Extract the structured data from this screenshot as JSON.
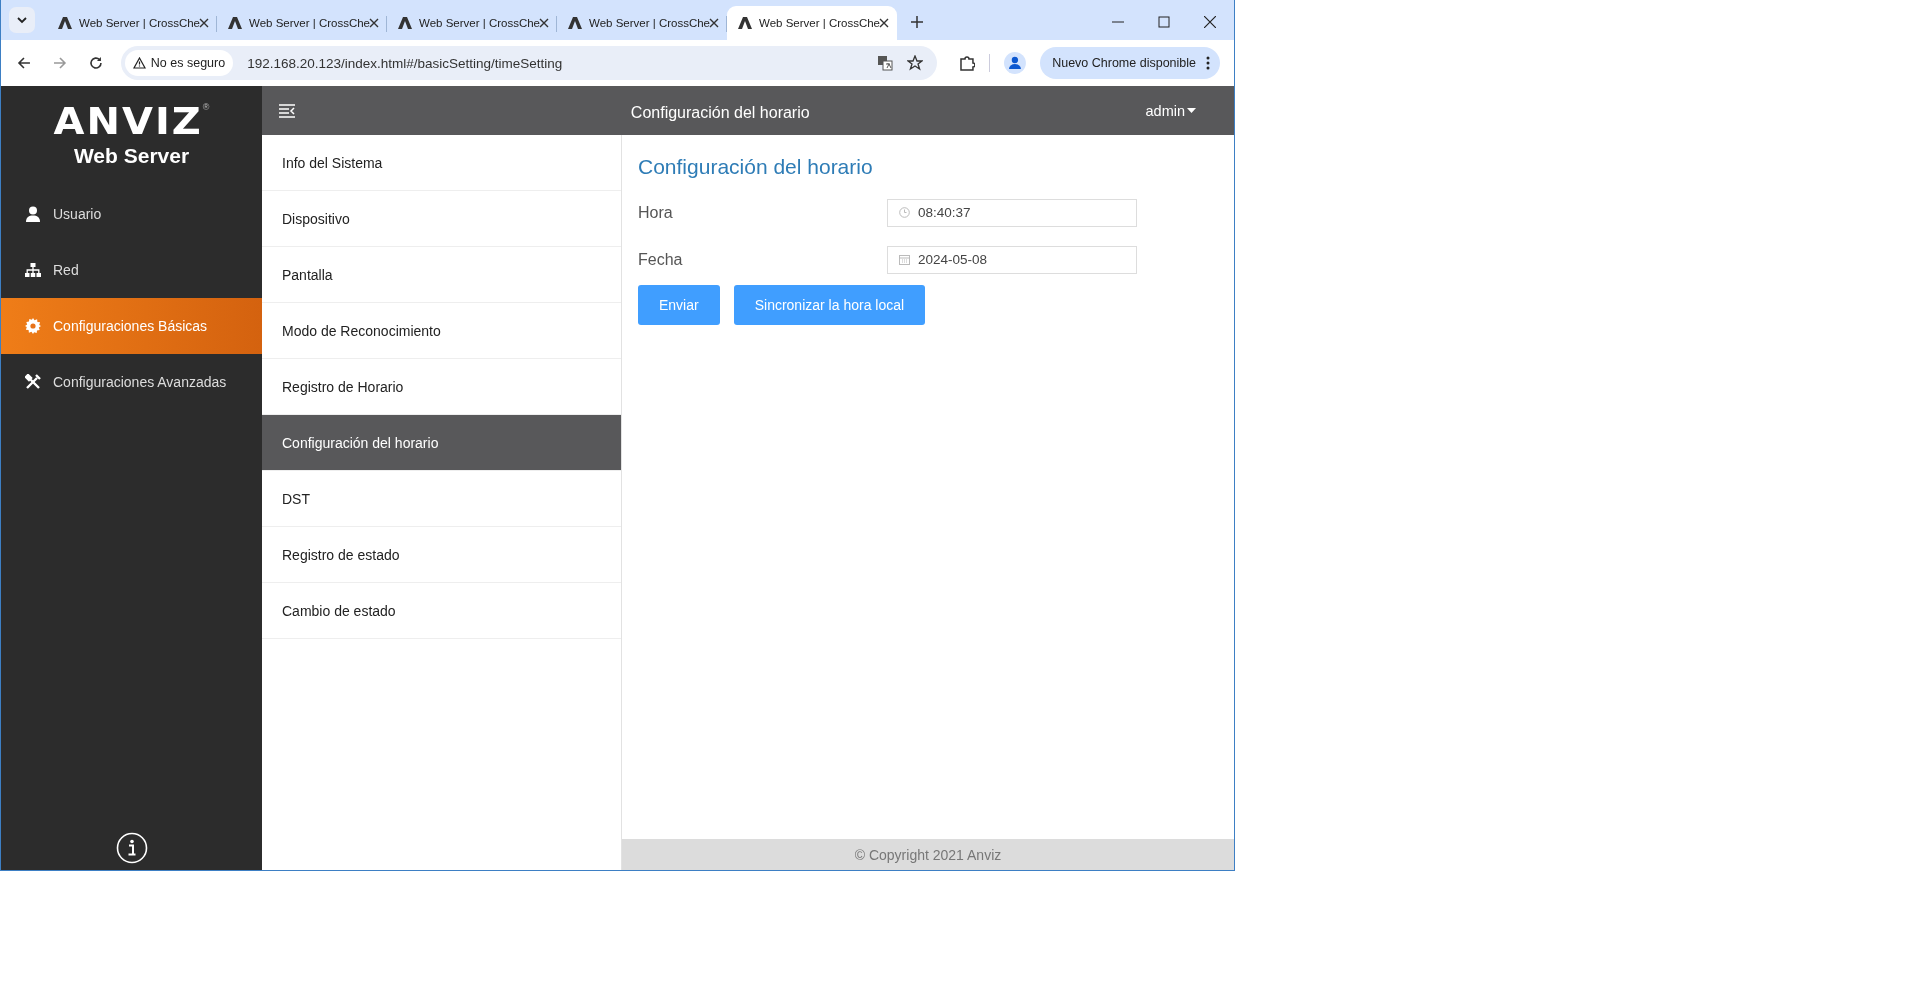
{
  "browser": {
    "tabs": [
      {
        "title": "Web Server | CrossChe",
        "selected": false
      },
      {
        "title": "Web Server | CrossChe",
        "selected": false
      },
      {
        "title": "Web Server | CrossChe",
        "selected": false
      },
      {
        "title": "Web Server | CrossChe",
        "selected": false
      },
      {
        "title": "Web Server | CrossChe",
        "selected": true
      }
    ],
    "security": "No es seguro",
    "url": "192.168.20.123/index.html#/basicSetting/timeSetting",
    "update_button": "Nuevo Chrome disponible"
  },
  "logo": {
    "brand": "ANVIZ",
    "reg": "®",
    "subtitle": "Web Server"
  },
  "sidebar": {
    "items": [
      {
        "label": "Usuario",
        "kind": "user",
        "selected": false
      },
      {
        "label": "Red",
        "kind": "network",
        "selected": false
      },
      {
        "label": "Configuraciones Básicas",
        "kind": "gear",
        "selected": true
      },
      {
        "label": "Configuraciones Avanzadas",
        "kind": "tools",
        "selected": false
      }
    ]
  },
  "header": {
    "title": "Configuración del horario",
    "user": "admin"
  },
  "submenu": {
    "items": [
      {
        "label": "Info del Sistema",
        "selected": false
      },
      {
        "label": "Dispositivo",
        "selected": false
      },
      {
        "label": "Pantalla",
        "selected": false
      },
      {
        "label": "Modo de Reconocimiento",
        "selected": false
      },
      {
        "label": "Registro de Horario",
        "selected": false
      },
      {
        "label": "Configuración del horario",
        "selected": true
      },
      {
        "label": "DST",
        "selected": false
      },
      {
        "label": "Registro de estado",
        "selected": false
      },
      {
        "label": "Cambio de estado",
        "selected": false
      }
    ]
  },
  "form": {
    "title": "Configuración del horario",
    "fields": [
      {
        "label": "Hora",
        "value": "08:40:37",
        "kind": "time"
      },
      {
        "label": "Fecha",
        "value": "2024-05-08",
        "kind": "date"
      }
    ],
    "buttons": [
      "Enviar",
      "Sincronizar la hora local"
    ]
  },
  "footer": "© Copyright 2021 Anviz"
}
